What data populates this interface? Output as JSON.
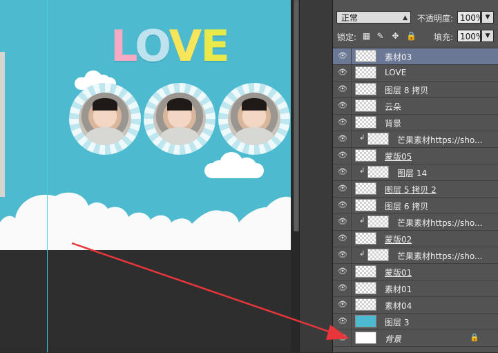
{
  "canvas": {
    "title_letters": [
      "L",
      "O",
      "V",
      "E"
    ]
  },
  "panel": {
    "blend_mode": "正常",
    "opacity_label": "不透明度:",
    "opacity_value": "100%",
    "lock_label": "锁定:",
    "fill_label": "填充:",
    "fill_value": "100%"
  },
  "layers": [
    {
      "name": "素材03",
      "selected": true,
      "thumb": "checker",
      "clipped": false,
      "underlined": false
    },
    {
      "name": "LOVE",
      "thumb": "checker"
    },
    {
      "name": "图层 8 拷贝",
      "thumb": "checker"
    },
    {
      "name": "云朵",
      "thumb": "checker"
    },
    {
      "name": "背景",
      "thumb": "checker"
    },
    {
      "name": "芒果素材https://sho...",
      "thumb": "checker",
      "clipped": true
    },
    {
      "name": "蒙版05",
      "thumb": "checker",
      "underlined": true
    },
    {
      "name": "图层 14",
      "thumb": "checker",
      "clipped": true
    },
    {
      "name": "图层 5 拷贝 2",
      "thumb": "checker",
      "underlined": true
    },
    {
      "name": "图层 6 拷贝",
      "thumb": "checker"
    },
    {
      "name": "芒果素材https://sho...",
      "thumb": "checker",
      "clipped": true
    },
    {
      "name": "蒙版02",
      "thumb": "checker",
      "underlined": true
    },
    {
      "name": "芒果素材https://sho...",
      "thumb": "checker",
      "clipped": true
    },
    {
      "name": "蒙版01",
      "thumb": "checker",
      "underlined": true
    },
    {
      "name": "素材01",
      "thumb": "checker"
    },
    {
      "name": "素材04",
      "thumb": "checker"
    },
    {
      "name": "图层 3",
      "thumb": "blue"
    },
    {
      "name": "背景",
      "thumb": "white",
      "italic": true,
      "locked": true
    }
  ],
  "colors": {
    "canvas_bg": "#4dbad0",
    "selection": "#6b7895",
    "panel_bg": "#535353",
    "arrow": "#e8363a"
  },
  "icons": {
    "visibility": "eye-icon",
    "clip": "clipping-arrow-icon",
    "lock": "lock-icon"
  }
}
